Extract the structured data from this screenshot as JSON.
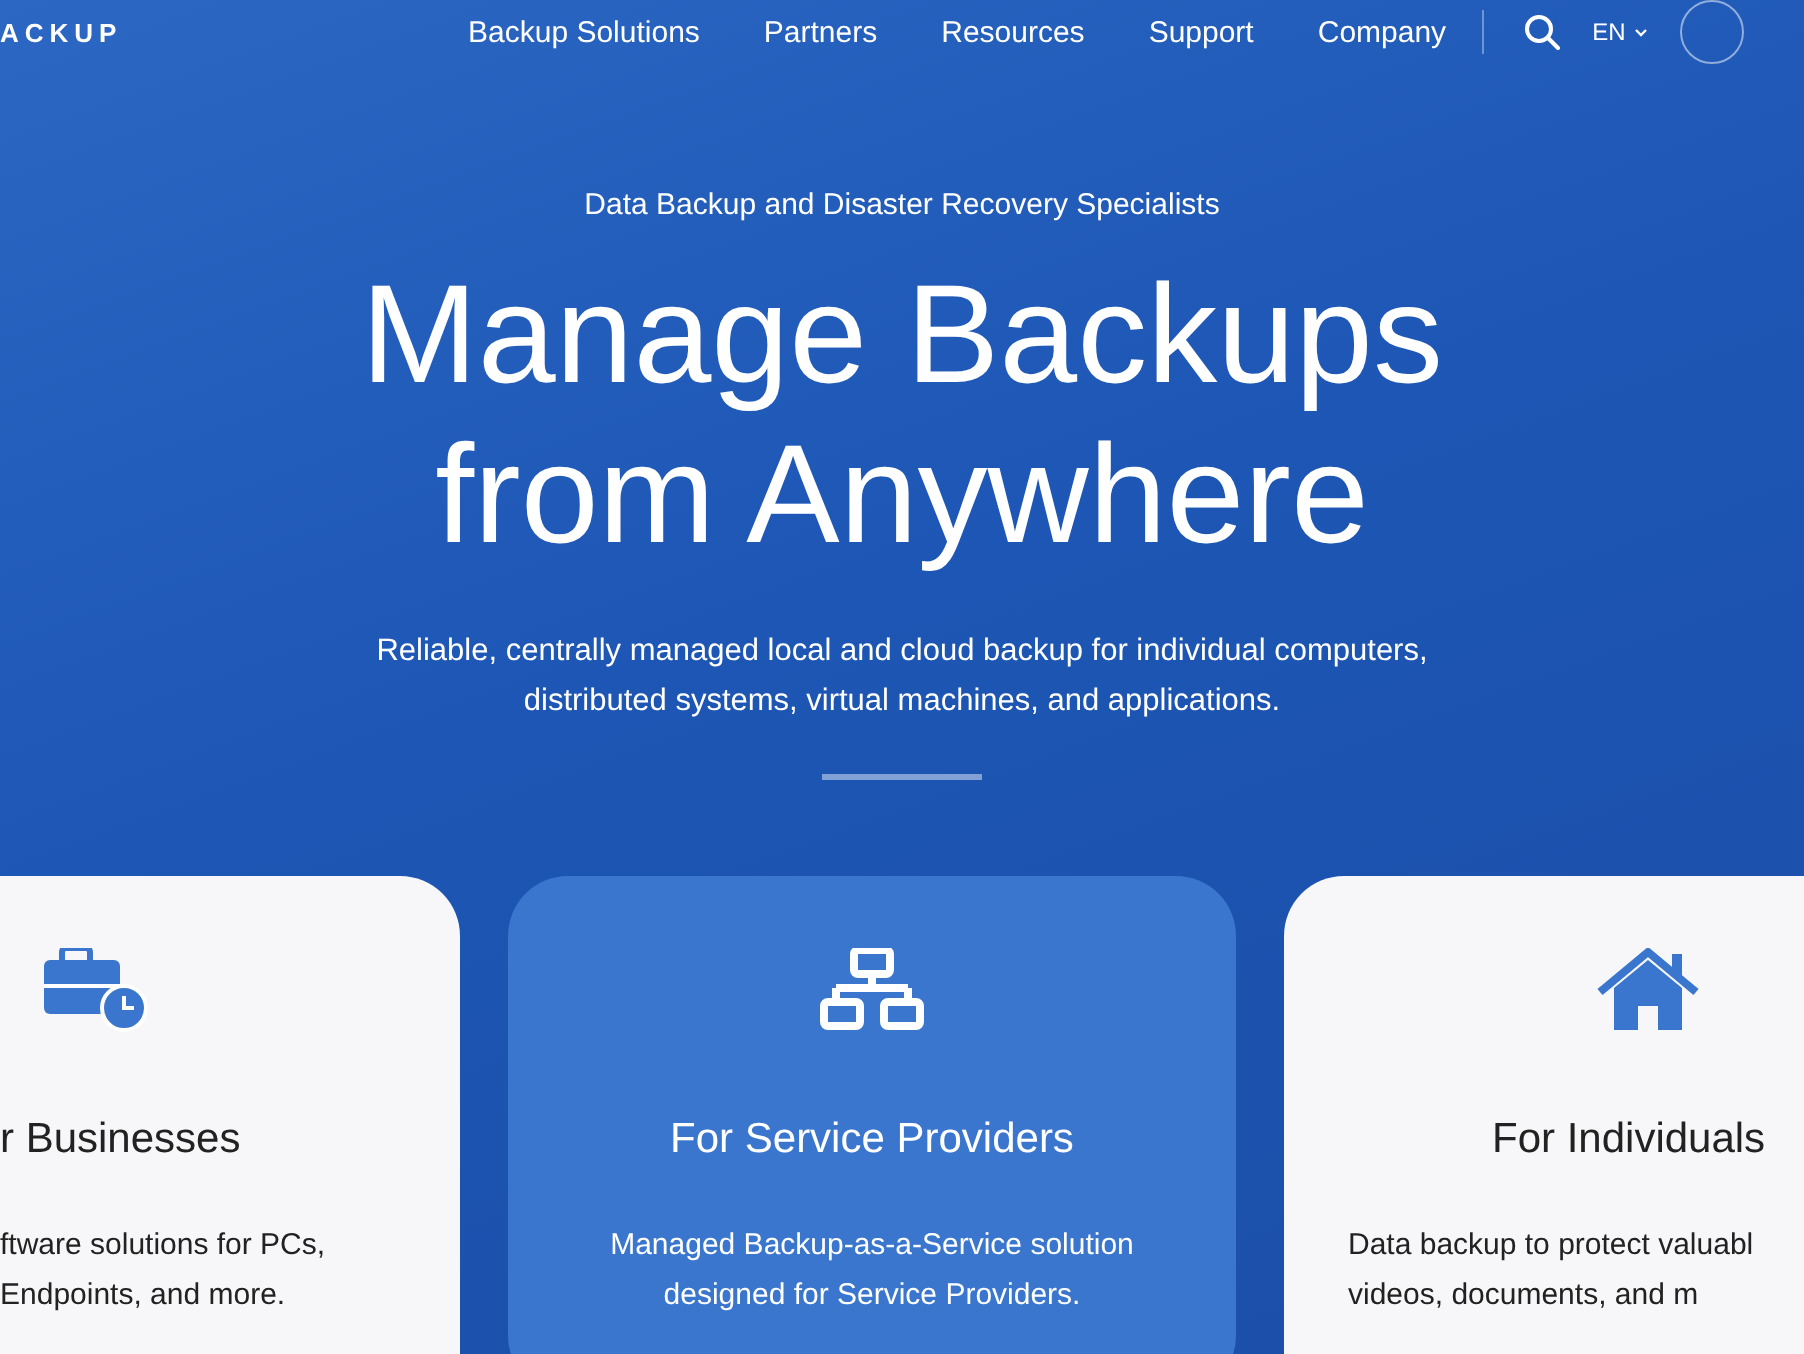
{
  "header": {
    "logo": "ACKUP",
    "nav": [
      {
        "label": "Backup Solutions"
      },
      {
        "label": "Partners"
      },
      {
        "label": "Resources"
      },
      {
        "label": "Support"
      },
      {
        "label": "Company"
      }
    ],
    "language": "EN"
  },
  "hero": {
    "eyebrow": "Data Backup and Disaster Recovery Specialists",
    "title_lines": [
      "Manage Backups",
      "from Anywhere"
    ],
    "description_lines": [
      "Reliable, centrally managed local and cloud backup for individual computers,",
      "distributed systems, virtual machines, and applications."
    ]
  },
  "cards": [
    {
      "kind": "business",
      "selected": false,
      "title": "r Businesses",
      "lines": [
        "ftware solutions for PCs,",
        "Endpoints, and more."
      ]
    },
    {
      "kind": "provider",
      "selected": true,
      "title": "For Service Providers",
      "lines": [
        "Managed Backup-as-a-Service solution",
        "designed for Service Providers."
      ]
    },
    {
      "kind": "home",
      "selected": false,
      "title": "For Individuals",
      "lines": [
        "Data backup to protect valuabl",
        "videos, documents, and m"
      ]
    }
  ]
}
